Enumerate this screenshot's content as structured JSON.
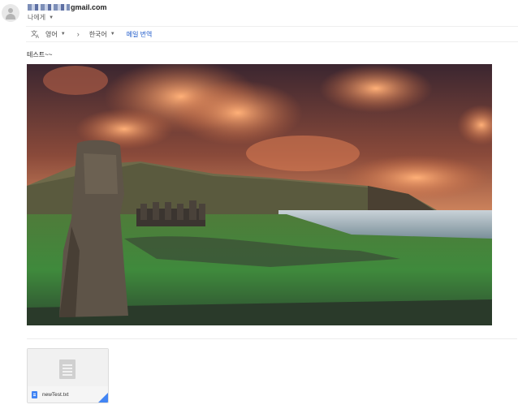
{
  "header": {
    "sender_email_suffix": "gmail.com",
    "recipient_label": "나에게"
  },
  "icons": {
    "avatar": "person-icon",
    "translate": "translate-icon",
    "recipient_dropdown": "chevron-down-icon",
    "attachment_type": "text-file-icon"
  },
  "translate_bar": {
    "source_language": "영어",
    "arrow": "›",
    "target_language": "한국어",
    "translate_link": "메일 번역"
  },
  "message": {
    "body_text": "테스트~~"
  },
  "attachment": {
    "file_name": "newTest.txt"
  },
  "colors": {
    "link": "#1a57c9",
    "attachment_accent": "#4285f4"
  }
}
